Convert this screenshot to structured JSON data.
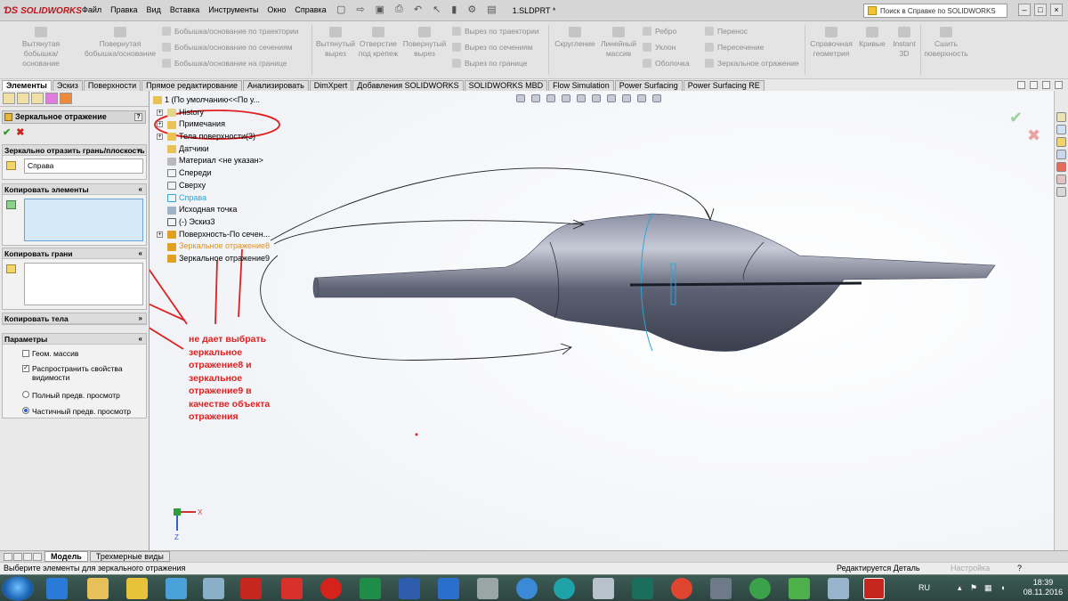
{
  "app": {
    "logo": "SOLIDWORKS",
    "title": "1.SLDPRT *",
    "menu": [
      "Файл",
      "Правка",
      "Вид",
      "Вставка",
      "Инструменты",
      "Окно",
      "Справка"
    ],
    "help_search_placeholder": "Поиск в Справке по SOLIDWORKS"
  },
  "ribbon": {
    "extruded_boss": "Вытянутая бобышка/основание",
    "revolved_boss": "Повернутая бобышка/основание",
    "swept_boss": "Бобышка/основание по траектории",
    "lofted_boss": "Бобышка/основание по сечениям",
    "boundary_boss": "Бобышка/основание на границе",
    "extruded_cut": "Вытянутый вырез",
    "hole_wizard": "Отверстие под крепеж",
    "revolved_cut": "Повернутый вырез",
    "swept_cut": "Вырез по траектории",
    "lofted_cut": "Вырез по сечениям",
    "boundary_cut": "Вырез по границе",
    "fillet": "Скругление",
    "linear_pattern": "Линейный массив",
    "rib": "Ребро",
    "draft": "Уклон",
    "shell": "Оболочка",
    "wrap": "Перенос",
    "intersect": "Пересечение",
    "mirror": "Зеркальное отражение",
    "ref_geometry": "Справочная геометрия",
    "curves": "Кривые",
    "instant3d": "Instant 3D",
    "knit": "Сшить поверхность"
  },
  "tabs": [
    "Элементы",
    "Эскиз",
    "Поверхности",
    "Прямое редактирование",
    "Анализировать",
    "DimXpert",
    "Добавления SOLIDWORKS",
    "SOLIDWORKS MBD",
    "Flow Simulation",
    "Power Surfacing",
    "Power Surfacing RE"
  ],
  "property_manager": {
    "title": "Зеркальное отражение",
    "mirror_plane_header": "Зеркально отразить грань/плоскость",
    "mirror_plane_value": "Справа",
    "copy_features_header": "Копировать элементы",
    "copy_faces_header": "Копировать грани",
    "copy_bodies_header": "Копировать тела",
    "params_header": "Параметры",
    "geom_pattern": "Геом. массив",
    "propagate_visual": "Распространить свойства видимости",
    "full_preview": "Полный предв. просмотр",
    "partial_preview": "Частичный предв. просмотр"
  },
  "tree": [
    {
      "label": "1  (По умолчанию<<По у...",
      "color": "#000000"
    },
    {
      "label": "History",
      "color": "#000000"
    },
    {
      "label": "Примечания",
      "color": "#000000"
    },
    {
      "label": "Тела поверхности(3)",
      "color": "#000000"
    },
    {
      "label": "Датчики",
      "color": "#000000"
    },
    {
      "label": "Материал <не указан>",
      "color": "#000000"
    },
    {
      "label": "Спереди",
      "color": "#000000"
    },
    {
      "label": "Сверху",
      "color": "#000000"
    },
    {
      "label": "Справа",
      "color": "#2aa6d8"
    },
    {
      "label": "Исходная точка",
      "color": "#000000"
    },
    {
      "label": "(-) Эскиз3",
      "color": "#000000"
    },
    {
      "label": "Поверхность-По сечен...",
      "color": "#000000"
    },
    {
      "label": "Зеркальное отражение8",
      "color": "#e0901e"
    },
    {
      "label": "Зеркальное отражение9",
      "color": "#000000"
    }
  ],
  "annotation": "не дает выбрать зеркальное отражение8 и зеркальное отражение9 в качестве объекта отражения",
  "triad": {
    "x": "X",
    "z": "Z"
  },
  "bottom_tabs": [
    "Модель",
    "Трехмерные виды"
  ],
  "status": {
    "message": "Выберите элементы для зеркального отражения",
    "editing": "Редактируется Деталь",
    "settings": "Настройка",
    "help": "?"
  },
  "taskbar": {
    "lang": "RU",
    "time": "18:39",
    "date": "08.11.2016"
  },
  "colors": {
    "annotation_red": "#e02020",
    "selected_blue": "#2aa6d8",
    "highlight_orange": "#e0901e"
  }
}
